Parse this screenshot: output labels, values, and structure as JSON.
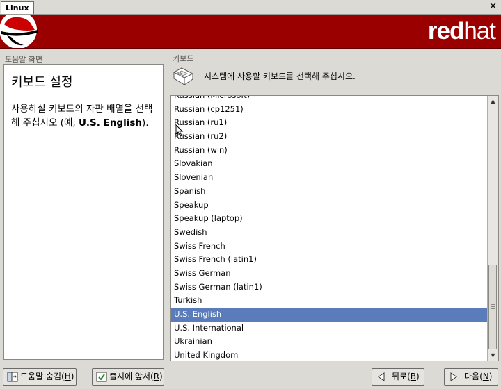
{
  "window": {
    "title": "Linux",
    "close_glyph": "✕"
  },
  "banner": {
    "brand_bold": "red",
    "brand_rest": "hat",
    "color": "#9b0000"
  },
  "help": {
    "pane_label": "도움말 화면",
    "title": "키보드 설정",
    "text_prefix": "사용하실 키보드의 자판 배열을 선택해 주십시오 (예, ",
    "text_example": "U.S. English",
    "text_suffix": ")."
  },
  "keyboard": {
    "section_label": "키보드",
    "instruction": "시스템에 사용할 키보드를 선택해 주십시오.",
    "icon": "keyboard-icon",
    "selected": "U.S. English",
    "items": [
      "Russian (Microsoft)",
      "Russian (cp1251)",
      "Russian (ru1)",
      "Russian (ru2)",
      "Russian (win)",
      "Slovakian",
      "Slovenian",
      "Spanish",
      "Speakup",
      "Speakup (laptop)",
      "Swedish",
      "Swiss French",
      "Swiss French (latin1)",
      "Swiss German",
      "Swiss German (latin1)",
      "Turkish",
      "U.S. English",
      "U.S. International",
      "Ukrainian",
      "United Kingdom"
    ]
  },
  "buttons": {
    "hide_help": {
      "label": "도움말 숨김(",
      "mnemonic": "H",
      "suffix": ")",
      "icon": "help-toggle-icon"
    },
    "release_notes": {
      "label": "출시에 앞서(",
      "mnemonic": "R",
      "suffix": ")",
      "icon": "release-notes-icon"
    },
    "back": {
      "label": "뒤로(",
      "mnemonic": "B",
      "suffix": ")",
      "icon": "back-arrow-icon"
    },
    "next": {
      "label": "다음(",
      "mnemonic": "N",
      "suffix": ")",
      "icon": "next-arrow-icon"
    }
  },
  "colors": {
    "selection": "#5b7cba",
    "background": "#dcdad5"
  }
}
